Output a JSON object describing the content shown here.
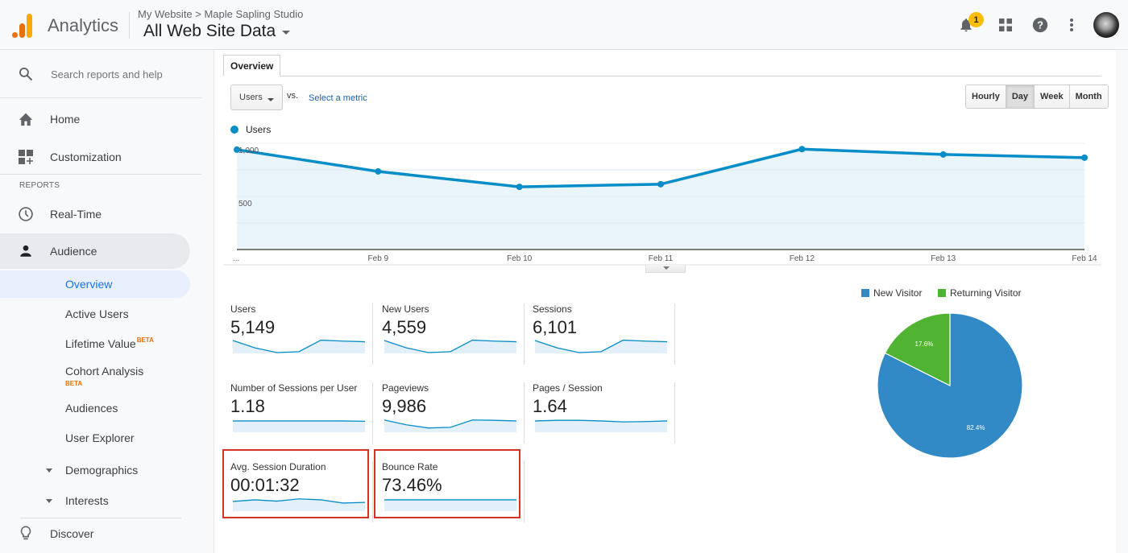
{
  "header": {
    "app_name": "Analytics",
    "breadcrumb": "My Website > Maple Sapling Studio",
    "view_name": "All Web Site Data",
    "notification_count": "1",
    "icons": [
      "bell-icon",
      "apps-grid-icon",
      "help-icon",
      "more-vert-icon",
      "avatar"
    ]
  },
  "sidebar": {
    "search_placeholder": "Search reports and help",
    "home": "Home",
    "customization": "Customization",
    "reports_heading": "REPORTS",
    "realtime": "Real-Time",
    "audience": "Audience",
    "audience_items": [
      {
        "label": "Overview",
        "active": true
      },
      {
        "label": "Active Users"
      },
      {
        "label": "Lifetime Value",
        "badge": "BETA"
      },
      {
        "label": "Cohort Analysis",
        "badge": "BETA"
      },
      {
        "label": "Audiences"
      },
      {
        "label": "User Explorer"
      },
      {
        "label": "Demographics",
        "expandable": true
      },
      {
        "label": "Interests",
        "expandable": true
      }
    ],
    "discover": "Discover"
  },
  "main": {
    "tab": "Overview",
    "metric_select": "Users",
    "vs_label": "vs.",
    "select_metric_link": "Select a metric",
    "granularity": [
      {
        "label": "Hourly"
      },
      {
        "label": "Day",
        "selected": true
      },
      {
        "label": "Week"
      },
      {
        "label": "Month"
      }
    ],
    "legend_label": "Users"
  },
  "chart_data": [
    {
      "type": "area",
      "title": "",
      "series": [
        {
          "name": "Users",
          "color": "#058dc7",
          "values": [
            940,
            735,
            590,
            615,
            945,
            895,
            865
          ]
        }
      ],
      "x": [
        "...",
        "Feb 9",
        "Feb 10",
        "Feb 11",
        "Feb 12",
        "Feb 13",
        "Feb 14"
      ],
      "y_ticks": [
        {
          "value": 500,
          "label": "500"
        },
        {
          "value": 1000,
          "label": "1,000"
        }
      ],
      "ylim": [
        0,
        1000
      ],
      "grid": true,
      "legend": "top-left"
    },
    {
      "type": "pie",
      "title": "",
      "categories": [
        "New Visitor",
        "Returning Visitor"
      ],
      "values": [
        82.4,
        17.6
      ],
      "labels": [
        "82.4%",
        "17.6%"
      ],
      "colors": [
        "#3189c6",
        "#50b432"
      ],
      "legend": "top"
    }
  ],
  "scorecards": [
    {
      "label": "Users",
      "value": "5,149",
      "spark": [
        0.95,
        0.72,
        0.57,
        0.6,
        0.96,
        0.93,
        0.91
      ],
      "highlighted": false
    },
    {
      "label": "New Users",
      "value": "4,559",
      "spark": [
        0.95,
        0.72,
        0.57,
        0.6,
        0.96,
        0.93,
        0.91
      ],
      "highlighted": false
    },
    {
      "label": "Sessions",
      "value": "6,101",
      "spark": [
        0.95,
        0.72,
        0.57,
        0.6,
        0.96,
        0.93,
        0.91
      ],
      "highlighted": false
    },
    {
      "label": "Number of Sessions per User",
      "value": "1.18",
      "spark": [
        0.9,
        0.9,
        0.9,
        0.9,
        0.9,
        0.9,
        0.89
      ],
      "highlighted": false
    },
    {
      "label": "Pageviews",
      "value": "9,986",
      "spark": [
        0.93,
        0.78,
        0.68,
        0.7,
        0.93,
        0.92,
        0.9
      ],
      "highlighted": false
    },
    {
      "label": "Pages / Session",
      "value": "1.64",
      "spark": [
        0.9,
        0.92,
        0.92,
        0.9,
        0.87,
        0.88,
        0.9
      ],
      "highlighted": false
    },
    {
      "label": "Avg. Session Duration",
      "value": "00:01:32",
      "spark": [
        0.85,
        0.9,
        0.86,
        0.93,
        0.9,
        0.8,
        0.82
      ],
      "highlighted": true
    },
    {
      "label": "Bounce Rate",
      "value": "73.46%",
      "spark": [
        0.9,
        0.9,
        0.9,
        0.9,
        0.9,
        0.9,
        0.9
      ],
      "highlighted": true
    }
  ],
  "colors": {
    "accent": "#1a73e8",
    "chart_line": "#058dc7",
    "chart_fill": "#e6f2fa",
    "highlight_border": "#d93025",
    "new_visitor": "#3189c6",
    "returning_visitor": "#50b432"
  }
}
